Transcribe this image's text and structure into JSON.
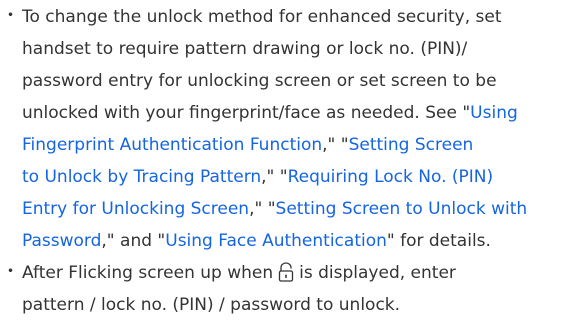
{
  "item1": {
    "bullet": "・",
    "line1": "To change the unlock method for enhanced security, set",
    "line2": "handset to require pattern drawing or lock no. (PIN)/",
    "line3": "password entry for unlocking screen or set screen to be",
    "line4_text": "unlocked with your fingerprint/face as needed. See \"",
    "line4_link": "Using",
    "line5_link": "Fingerprint Authentication Function",
    "line5_text": ",\" \"",
    "line5_link2": "Setting Screen",
    "line6_link": "to Unlock by Tracing Pattern",
    "line6_text": ",\" \"",
    "line6_link2": "Requiring Lock No. (PIN)",
    "line7_link": "Entry for Unlocking Screen",
    "line7_text": ",\" \"",
    "line7_link2": "Setting Screen to Unlock with",
    "line8_link": "Password",
    "line8_text": ",\" and \"",
    "line8_link2": "Using Face Authentication",
    "line8_text2": "\" for details."
  },
  "item2": {
    "bullet": "・",
    "line1_before": "After Flicking screen up when",
    "line1_after": "is displayed, enter",
    "line2": "pattern / lock no. (PIN) / password to unlock."
  },
  "icons": {
    "lock": "unlock-icon"
  },
  "colors": {
    "text": "#333333",
    "link": "#1565e0"
  }
}
